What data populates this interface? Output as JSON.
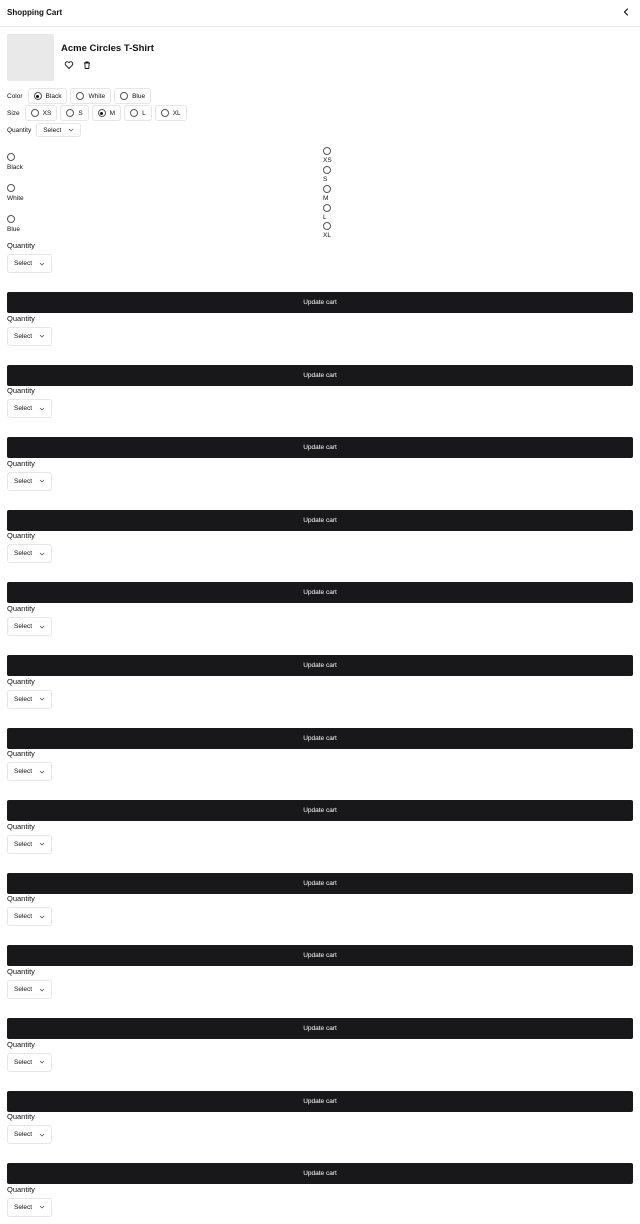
{
  "header": {
    "title": "Shopping Cart",
    "back_icon": "chevron-left-icon"
  },
  "product": {
    "name": "Acme Circles T-Shirt",
    "favorite_icon": "heart-icon",
    "delete_icon": "trash-icon"
  },
  "color": {
    "label": "Color",
    "options": [
      "Black",
      "White",
      "Blue"
    ],
    "selected": "Black"
  },
  "size": {
    "label": "Size",
    "options": [
      "XS",
      "S",
      "M",
      "L",
      "XL"
    ],
    "selected": "M"
  },
  "quantity_inline": {
    "label": "Quantity",
    "value": "Select"
  },
  "color_stack": [
    "Black",
    "White",
    "Blue"
  ],
  "size_stack": [
    "XS",
    "S",
    "M",
    "L",
    "XL"
  ],
  "quantity_sections": {
    "label": "Quantity",
    "select_value": "Select",
    "button_label": "Update cart",
    "button_color": "#18181b"
  }
}
